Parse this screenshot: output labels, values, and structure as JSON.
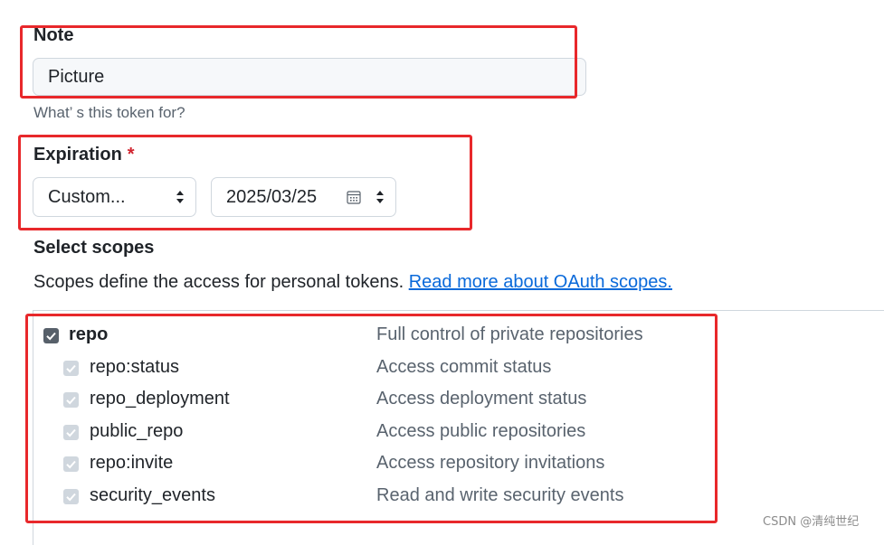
{
  "note": {
    "label": "Note",
    "value": "Picture",
    "hint": "What’ s this token for?"
  },
  "expiration": {
    "label": "Expiration",
    "required_mark": "*",
    "selected_option": "Custom...",
    "date_value": "2025/03/25"
  },
  "scopes": {
    "title": "Select scopes",
    "description": "Scopes define the access for personal tokens.",
    "link_text": "Read more about OAuth scopes.",
    "parent": {
      "name": "repo",
      "description": "Full control of private repositories",
      "checked": true
    },
    "children": [
      {
        "name": "repo:status",
        "description": "Access commit status",
        "checked": true
      },
      {
        "name": "repo_deployment",
        "description": "Access deployment status",
        "checked": true
      },
      {
        "name": "public_repo",
        "description": "Access public repositories",
        "checked": true
      },
      {
        "name": "repo:invite",
        "description": "Access repository invitations",
        "checked": true
      },
      {
        "name": "security_events",
        "description": "Read and write security events",
        "checked": true
      }
    ]
  },
  "annotation_color": "#e8282b",
  "link_color": "#0969da",
  "watermark": "CSDN @清纯世纪"
}
